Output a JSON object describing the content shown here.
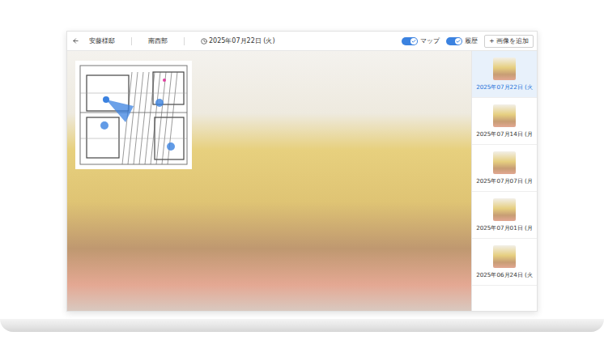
{
  "header": {
    "project": "安藤様邸",
    "area": "南西部",
    "date": "2025年07月22日 (火)"
  },
  "toggles": [
    {
      "label": "マップ",
      "on": true
    },
    {
      "label": "履歴",
      "on": true
    }
  ],
  "add_button": "+ 画像を追加",
  "history": [
    {
      "date": "2025年07月22日 (火",
      "selected": true
    },
    {
      "date": "2025年07月14日 (月",
      "selected": false
    },
    {
      "date": "2025年07月07日 (月",
      "selected": false
    },
    {
      "date": "2025年07月01日 (月",
      "selected": false
    },
    {
      "date": "2025年06月24日 (火",
      "selected": false
    }
  ]
}
